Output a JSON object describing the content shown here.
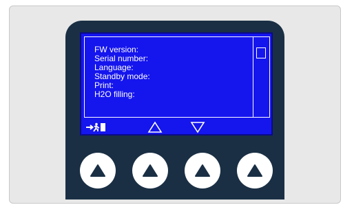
{
  "screen": {
    "menu_items": [
      "FW version:",
      "Serial number:",
      "Language:",
      "Standby mode:",
      "Print:",
      "H2O filling:"
    ],
    "softkeys": [
      {
        "icon": "exit-icon"
      },
      {
        "icon": "up-arrow-outline-icon"
      },
      {
        "icon": "down-arrow-outline-icon"
      }
    ],
    "colors": {
      "screen_bg": "#1515ee",
      "text": "#ffffff",
      "device_body": "#1a2f44"
    }
  },
  "hardware_buttons": [
    {
      "icon": "up-triangle-icon"
    },
    {
      "icon": "up-triangle-icon"
    },
    {
      "icon": "up-triangle-icon"
    },
    {
      "icon": "up-triangle-icon"
    }
  ]
}
